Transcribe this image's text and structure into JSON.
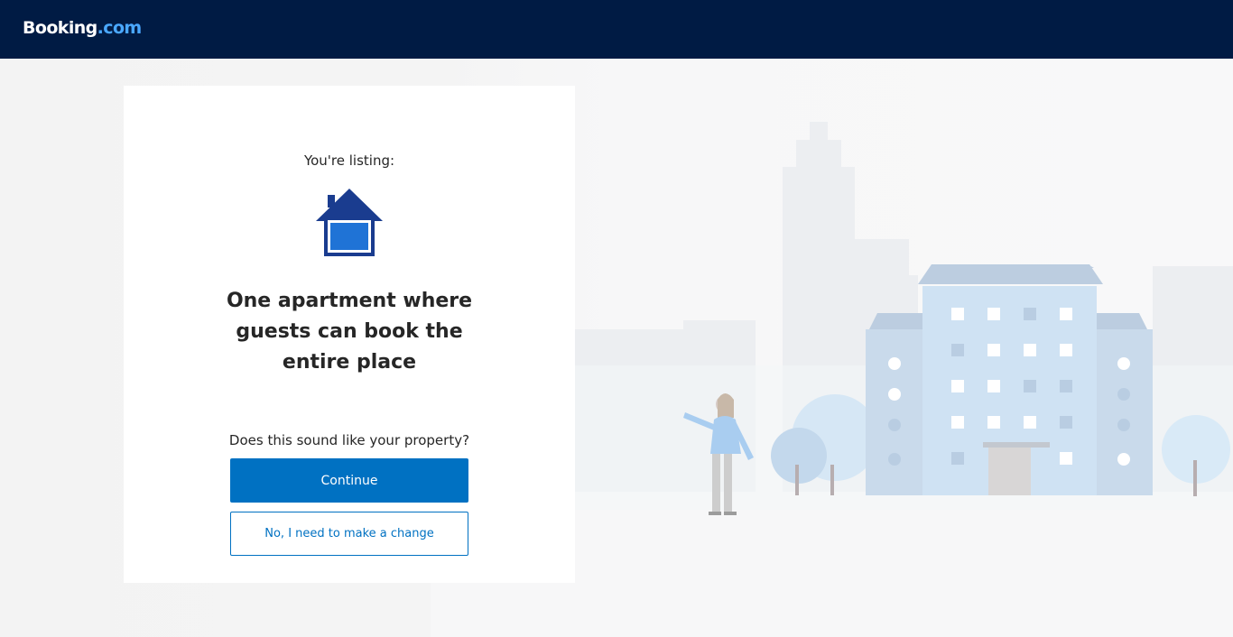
{
  "header": {
    "logo_text": "Booking",
    "logo_suffix": ".com"
  },
  "card": {
    "listing_label": "You're listing:",
    "icon": "house-icon",
    "property_title": "One apartment where guests can book the entire place",
    "question": "Does this sound like your property?",
    "continue_label": "Continue",
    "change_label": "No, I need to make a change"
  },
  "colors": {
    "header_bg": "#001b44",
    "accent": "#0071c2",
    "house_dark": "#1a3c8f",
    "house_light": "#1f73d6"
  }
}
